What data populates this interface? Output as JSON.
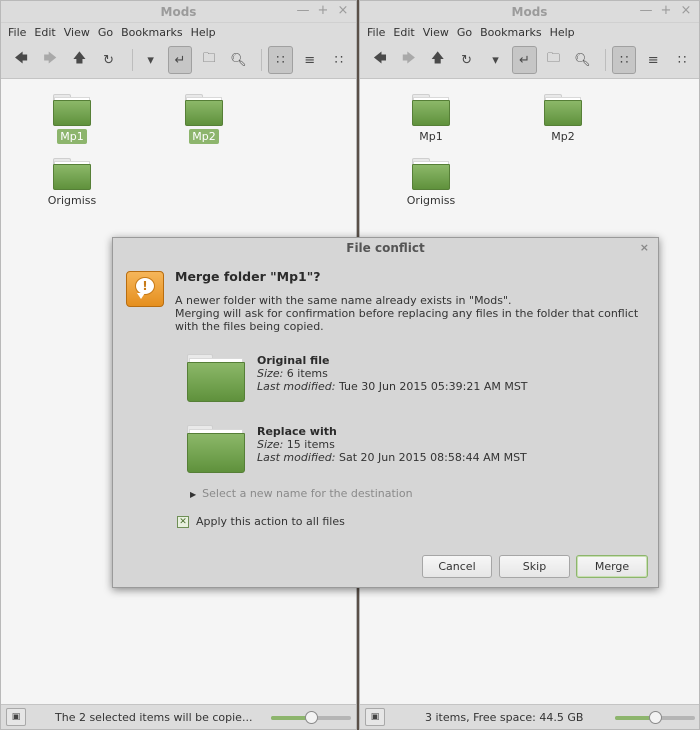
{
  "left_window": {
    "title": "Mods",
    "window_buttons": [
      "—",
      "+",
      "×"
    ],
    "menus": [
      "File",
      "Edit",
      "View",
      "Go",
      "Bookmarks",
      "Help"
    ],
    "items": [
      {
        "label": "Mp1",
        "selected": true
      },
      {
        "label": "Mp2",
        "selected": true
      },
      {
        "label": "Origmiss",
        "selected": false
      }
    ],
    "status": "The 2 selected items will be copie...",
    "zoom_fraction": 0.55
  },
  "right_window": {
    "title": "Mods",
    "window_buttons": [
      "—",
      "+",
      "×"
    ],
    "menus": [
      "File",
      "Edit",
      "View",
      "Go",
      "Bookmarks",
      "Help"
    ],
    "items": [
      {
        "label": "Mp1",
        "selected": false
      },
      {
        "label": "Mp2",
        "selected": false
      },
      {
        "label": "Origmiss",
        "selected": false
      }
    ],
    "status": "3 items, Free space: 44.5 GB",
    "zoom_fraction": 0.55
  },
  "toolbar_icons": [
    "back-icon",
    "forward-icon",
    "up-icon",
    "reload-icon",
    "dropdown-icon",
    "toggle-location-icon",
    "folder-compare-icon",
    "search-icon",
    "icon-view-icon",
    "list-view-icon",
    "compact-view-icon"
  ],
  "dialog": {
    "title": "File conflict",
    "close": "×",
    "heading": "Merge folder \"Mp1\"?",
    "description_line1": "A newer folder with the same name already exists in \"Mods\".",
    "description_line2": "Merging will ask for confirmation before replacing any files in the folder that conflict with the files being copied.",
    "original": {
      "label": "Original file",
      "size_label": "Size:",
      "size_value": "6 items",
      "modified_label": "Last modified:",
      "modified_value": "Tue 30 Jun 2015 05:39:21 AM MST"
    },
    "replacement": {
      "label": "Replace with",
      "size_label": "Size:",
      "size_value": "15 items",
      "modified_label": "Last modified:",
      "modified_value": "Sat 20 Jun 2015 08:58:44 AM MST"
    },
    "rename_expander": "Select a new name for the destination",
    "apply_all_label": "Apply this action to all files",
    "apply_all_checked": true,
    "buttons": {
      "cancel": "Cancel",
      "skip": "Skip",
      "merge": "Merge"
    }
  },
  "colors": {
    "accent": "#8db56d",
    "folder_green": "#6f9f4a",
    "warning_orange": "#f0a030"
  }
}
